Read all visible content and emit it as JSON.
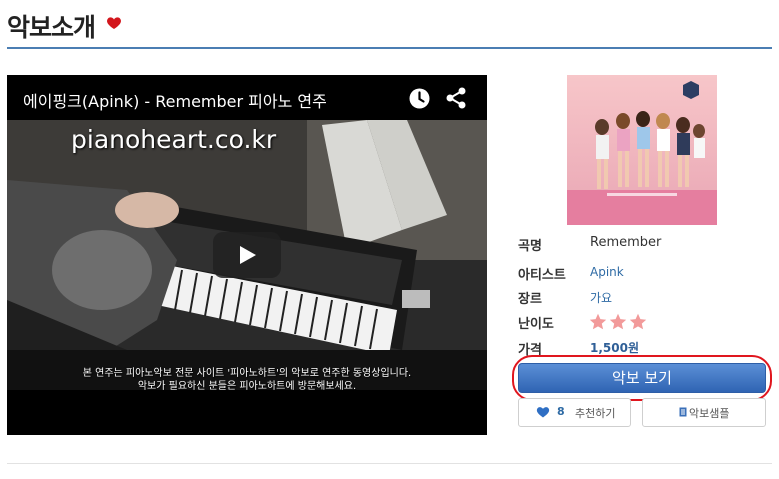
{
  "page": {
    "title": "악보소개"
  },
  "video": {
    "title": "에이핑크(Apink) - Remember 피아노 연주",
    "watermark": "pianoheart.co.kr",
    "subtitle_line1": "본 연주는 피아노악보 전문 사이트 '피아노하트'의 악보로 연주한 동영상입니다.",
    "subtitle_line2": "악보가 필요하신 분들은 피아노하트에 방문해보세요."
  },
  "info": {
    "song_label": "곡명",
    "song_value": "Remember",
    "artist_label": "아티스트",
    "artist_value": "Apink",
    "genre_label": "장르",
    "genre_value": "가요",
    "difficulty_label": "난이도",
    "difficulty_stars": 3,
    "price_label": "가격",
    "price_value": "1,500원"
  },
  "actions": {
    "view_label": "악보 보기",
    "like_count": "8",
    "like_label": "추천하기",
    "sample_label": "악보샘플"
  },
  "colors": {
    "accent": "#4b7eb3",
    "link": "#2f6ba5",
    "button": "#3b6fbf",
    "highlight": "#e0161e",
    "star": "#f29a9a"
  }
}
